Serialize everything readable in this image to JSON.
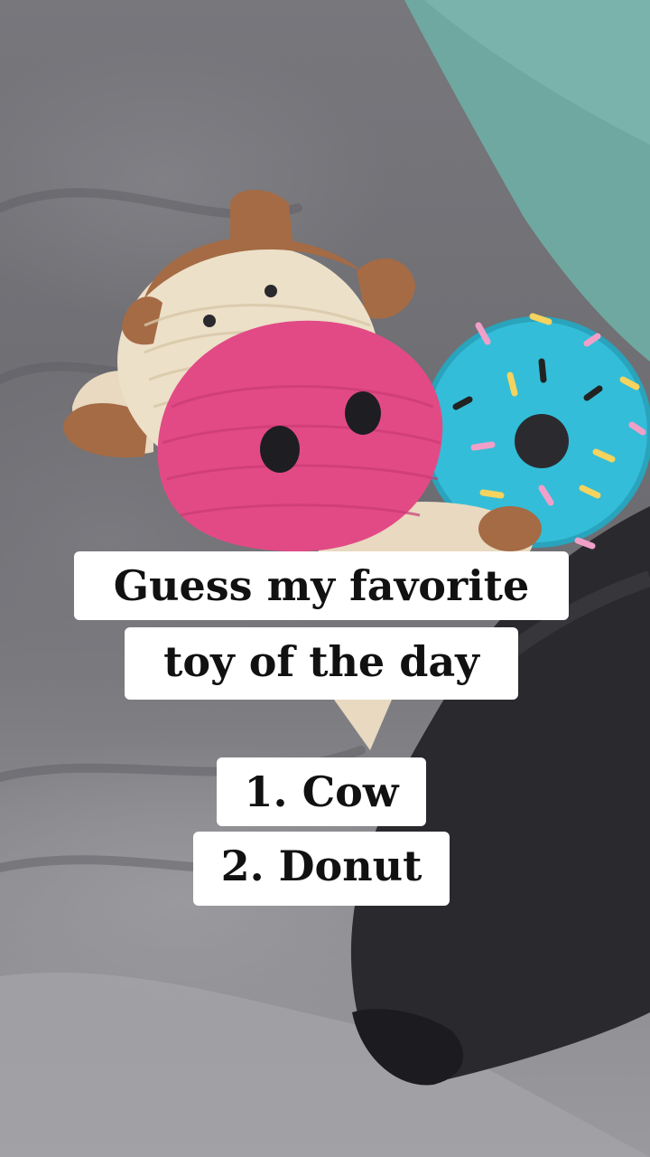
{
  "caption": {
    "line1": "Guess my favorite",
    "line2": "toy of the day"
  },
  "options": {
    "option1": "1. Cow",
    "option2": "2. Donut"
  },
  "colors": {
    "blanket": "#75757a",
    "pillow": "#6fa8a0",
    "cow_nose": "#e24a86",
    "donut": "#33bdd8",
    "dog_fur": "#2a2a2e"
  }
}
